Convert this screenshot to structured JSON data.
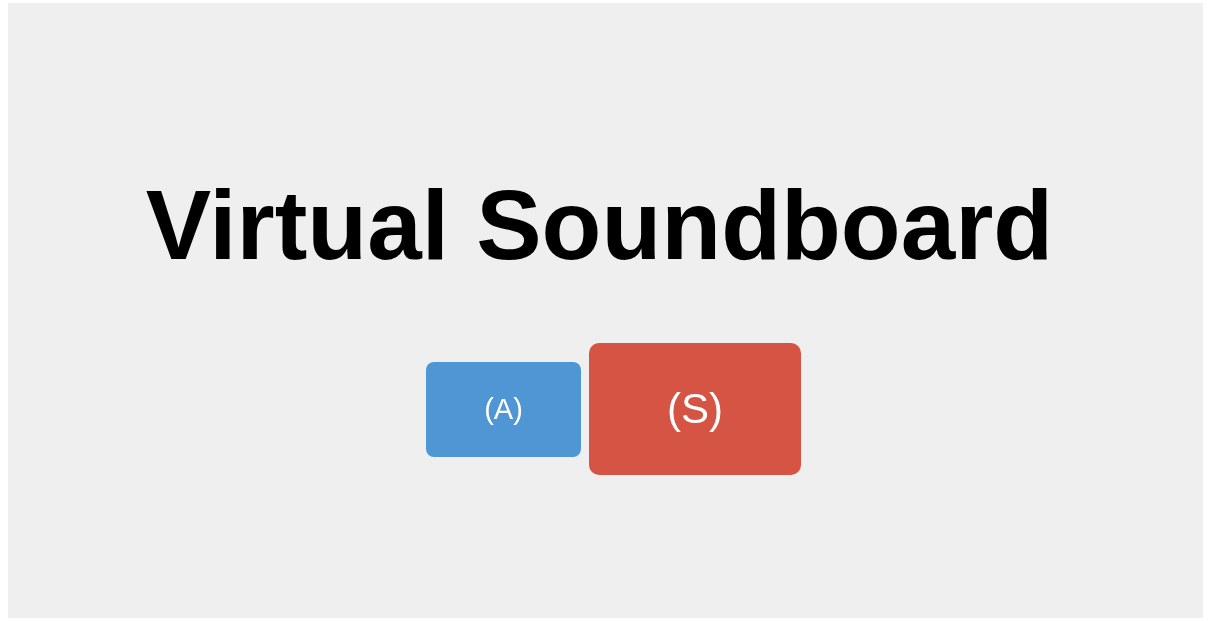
{
  "title": "Virtual Soundboard",
  "pads": [
    {
      "label": "(A)",
      "color": "#4f96d4",
      "active": false
    },
    {
      "label": "(S)",
      "color": "#d65444",
      "active": true
    }
  ]
}
